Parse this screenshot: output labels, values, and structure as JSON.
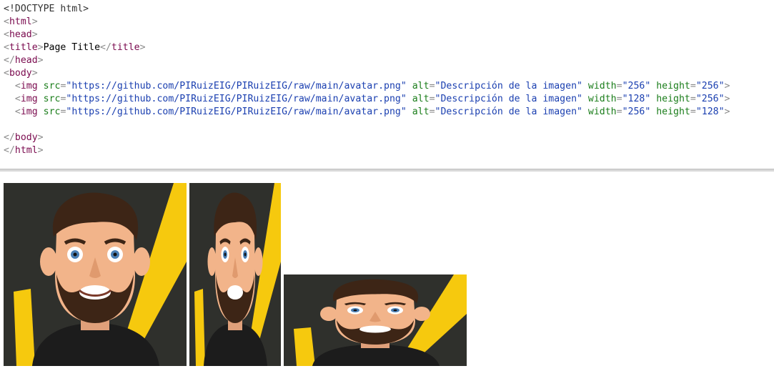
{
  "code": {
    "lines": [
      [
        {
          "t": "doctype",
          "s": "<!DOCTYPE html>"
        }
      ],
      [
        {
          "t": "punct",
          "s": "<"
        },
        {
          "t": "tag",
          "s": "html"
        },
        {
          "t": "punct",
          "s": ">"
        }
      ],
      [
        {
          "t": "punct",
          "s": "<"
        },
        {
          "t": "tag",
          "s": "head"
        },
        {
          "t": "punct",
          "s": ">"
        }
      ],
      [
        {
          "t": "punct",
          "s": "<"
        },
        {
          "t": "tag",
          "s": "title"
        },
        {
          "t": "punct",
          "s": ">"
        },
        {
          "t": "text",
          "s": "Page Title"
        },
        {
          "t": "punct",
          "s": "</"
        },
        {
          "t": "tag",
          "s": "title"
        },
        {
          "t": "punct",
          "s": ">"
        }
      ],
      [
        {
          "t": "punct",
          "s": "</"
        },
        {
          "t": "tag",
          "s": "head"
        },
        {
          "t": "punct",
          "s": ">"
        }
      ],
      [
        {
          "t": "punct",
          "s": "<"
        },
        {
          "t": "tag",
          "s": "body"
        },
        {
          "t": "punct",
          "s": ">"
        }
      ],
      [
        {
          "t": "text",
          "s": "  "
        },
        {
          "t": "punct",
          "s": "<"
        },
        {
          "t": "tag",
          "s": "img"
        },
        {
          "t": "text",
          "s": " "
        },
        {
          "t": "attr",
          "s": "src"
        },
        {
          "t": "punct",
          "s": "="
        },
        {
          "t": "val",
          "s": "\"https://github.com/PIRuizEIG/PIRuizEIG/raw/main/avatar.png\""
        },
        {
          "t": "text",
          "s": " "
        },
        {
          "t": "attr",
          "s": "alt"
        },
        {
          "t": "punct",
          "s": "="
        },
        {
          "t": "val",
          "s": "\"Descripción de la imagen\""
        },
        {
          "t": "text",
          "s": " "
        },
        {
          "t": "attr",
          "s": "width"
        },
        {
          "t": "punct",
          "s": "="
        },
        {
          "t": "val",
          "s": "\"256\""
        },
        {
          "t": "text",
          "s": " "
        },
        {
          "t": "attr",
          "s": "height"
        },
        {
          "t": "punct",
          "s": "="
        },
        {
          "t": "val",
          "s": "\"256\""
        },
        {
          "t": "punct",
          "s": ">"
        }
      ],
      [
        {
          "t": "text",
          "s": "  "
        },
        {
          "t": "punct",
          "s": "<"
        },
        {
          "t": "tag",
          "s": "img"
        },
        {
          "t": "text",
          "s": " "
        },
        {
          "t": "attr",
          "s": "src"
        },
        {
          "t": "punct",
          "s": "="
        },
        {
          "t": "val",
          "s": "\"https://github.com/PIRuizEIG/PIRuizEIG/raw/main/avatar.png\""
        },
        {
          "t": "text",
          "s": " "
        },
        {
          "t": "attr",
          "s": "alt"
        },
        {
          "t": "punct",
          "s": "="
        },
        {
          "t": "val",
          "s": "\"Descripción de la imagen\""
        },
        {
          "t": "text",
          "s": " "
        },
        {
          "t": "attr",
          "s": "width"
        },
        {
          "t": "punct",
          "s": "="
        },
        {
          "t": "val",
          "s": "\"128\""
        },
        {
          "t": "text",
          "s": " "
        },
        {
          "t": "attr",
          "s": "height"
        },
        {
          "t": "punct",
          "s": "="
        },
        {
          "t": "val",
          "s": "\"256\""
        },
        {
          "t": "punct",
          "s": ">"
        }
      ],
      [
        {
          "t": "text",
          "s": "  "
        },
        {
          "t": "punct",
          "s": "<"
        },
        {
          "t": "tag",
          "s": "img"
        },
        {
          "t": "text",
          "s": " "
        },
        {
          "t": "attr",
          "s": "src"
        },
        {
          "t": "punct",
          "s": "="
        },
        {
          "t": "val",
          "s": "\"https://github.com/PIRuizEIG/PIRuizEIG/raw/main/avatar.png\""
        },
        {
          "t": "text",
          "s": " "
        },
        {
          "t": "attr",
          "s": "alt"
        },
        {
          "t": "punct",
          "s": "="
        },
        {
          "t": "val",
          "s": "\"Descripción de la imagen\""
        },
        {
          "t": "text",
          "s": " "
        },
        {
          "t": "attr",
          "s": "width"
        },
        {
          "t": "punct",
          "s": "="
        },
        {
          "t": "val",
          "s": "\"256\""
        },
        {
          "t": "text",
          "s": " "
        },
        {
          "t": "attr",
          "s": "height"
        },
        {
          "t": "punct",
          "s": "="
        },
        {
          "t": "val",
          "s": "\"128\""
        },
        {
          "t": "punct",
          "s": ">"
        }
      ],
      [],
      [
        {
          "t": "punct",
          "s": "</"
        },
        {
          "t": "tag",
          "s": "body"
        },
        {
          "t": "punct",
          "s": ">"
        }
      ],
      [
        {
          "t": "punct",
          "s": "</"
        },
        {
          "t": "tag",
          "s": "html"
        },
        {
          "t": "punct",
          "s": ">"
        }
      ]
    ]
  },
  "preview": {
    "images": [
      {
        "name": "avatar-image-256x256",
        "icon": "avatar-portrait-icon"
      },
      {
        "name": "avatar-image-128x256",
        "icon": "avatar-portrait-icon"
      },
      {
        "name": "avatar-image-256x128",
        "icon": "avatar-portrait-icon"
      }
    ]
  },
  "colors": {
    "tag": "#7a0a4e",
    "attribute": "#1a7d1a",
    "value": "#1a3fb0",
    "punctuation": "#8a8a8a",
    "avatar_background": "#2f302c",
    "avatar_accent": "#f6c90e",
    "avatar_shirt": "#1c1c1c",
    "avatar_skin": "#f2b48a",
    "avatar_hair": "#3d2516"
  }
}
